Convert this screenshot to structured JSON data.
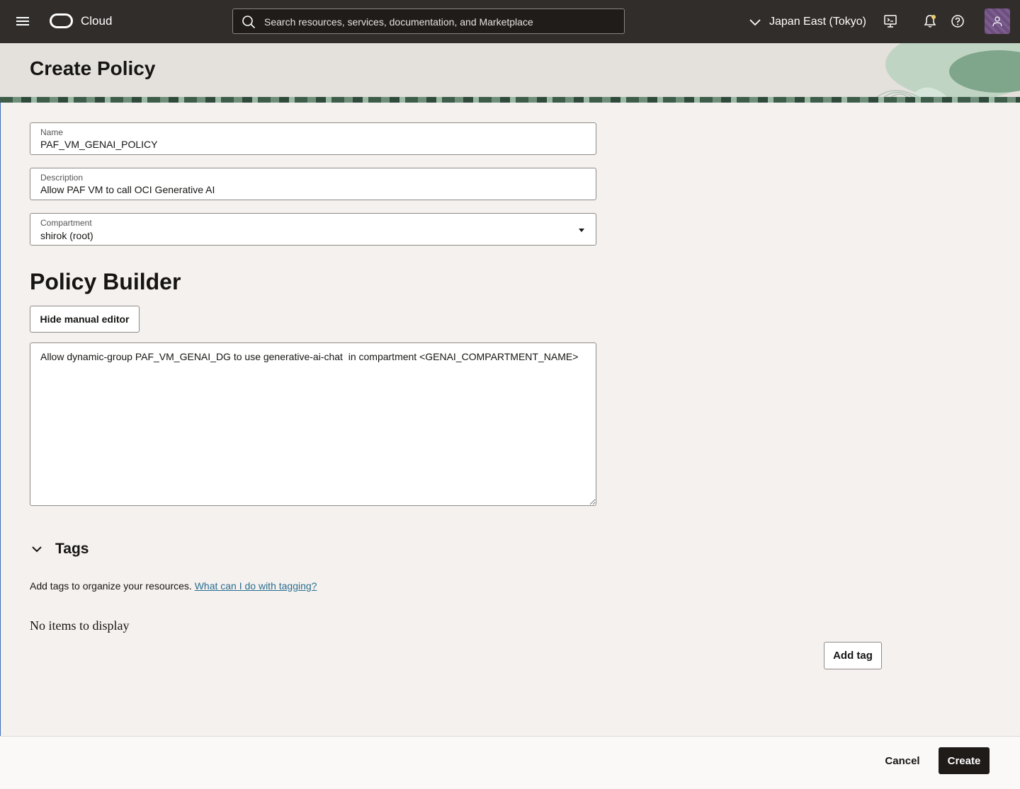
{
  "header": {
    "brand": "Cloud",
    "search_placeholder": "Search resources, services, documentation, and Marketplace",
    "region": "Japan East (Tokyo)"
  },
  "page": {
    "title": "Create Policy"
  },
  "form": {
    "name": {
      "label": "Name",
      "value": "PAF_VM_GENAI_POLICY"
    },
    "description": {
      "label": "Description",
      "value": "Allow PAF VM to call OCI Generative AI"
    },
    "compartment": {
      "label": "Compartment",
      "value": "shirok (root)"
    }
  },
  "policy_builder": {
    "title": "Policy Builder",
    "toggle_label": "Hide manual editor",
    "statement": "Allow dynamic-group PAF_VM_GENAI_DG to use generative-ai-chat  in compartment <GENAI_COMPARTMENT_NAME>"
  },
  "tags": {
    "title": "Tags",
    "description": "Add tags to organize your resources.",
    "help_link": "What can I do with tagging?",
    "empty_message": "No items to display",
    "add_label": "Add tag"
  },
  "footer": {
    "cancel_label": "Cancel",
    "create_label": "Create"
  },
  "icons": [
    "menu-icon",
    "cloud-logo-icon",
    "search-icon",
    "chevron-down-icon",
    "cloud-shell-icon",
    "bell-icon",
    "help-icon",
    "user-icon"
  ]
}
